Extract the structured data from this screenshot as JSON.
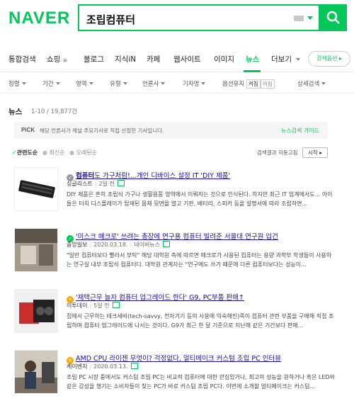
{
  "header": {
    "logo": "NAVER",
    "query": "조립컴퓨터"
  },
  "tabs": [
    {
      "label": "통합검색"
    },
    {
      "label": "쇼핑"
    },
    {
      "label": "블로그"
    },
    {
      "label": "지식iN"
    },
    {
      "label": "카페"
    },
    {
      "label": "웹사이트"
    },
    {
      "label": "이미지"
    },
    {
      "label": "뉴스"
    },
    {
      "label": "더보기"
    }
  ],
  "search_option_label": "검색옵션 ▸",
  "filters": [
    "정렬",
    "기간",
    "영역",
    "유형",
    "언론사",
    "기자명",
    "옵션유지",
    "상세검색"
  ],
  "option_toggle": {
    "on": "켜짐",
    "off": "꺼짐"
  },
  "news": {
    "title": "뉴스",
    "count": "1-10 / 19,877건"
  },
  "pick": {
    "label": "PiCK",
    "desc": "해당 언론사가 채널 주요기사로 직접 선정한 기사입니다.",
    "guide": "뉴스검색 가이드"
  },
  "sort": {
    "relevance": "관련도순",
    "latest": "최신순",
    "oldest": "오래된순",
    "auto": "검색결과 자동고침",
    "start": "시작 ▸"
  },
  "items": [
    {
      "title_hl": "컴퓨터",
      "title": "도 가구처럼!...개인 디바이스 설정 IT 'DIY 제품'",
      "press": "싱글리스트",
      "date": "2일 전",
      "desc": "DIY 제품은 흔히 조립식 가구나 생활용품 영역에서 이뤄지는 것으로 인식된다. 하지만 최근 IT 업계에서도... 아이들은 터치 디스플레이가 탑재된 몸체 뒷면을 열고 기판, 배터리, 스피커 등을 설명서에 따라 조립하면..."
    },
    {
      "title_hl": "컴퓨터",
      "title": "'미스크 매크로' 쓰려는 총장에 연구용 컴퓨터 빌려준 서울대 연구원 입건",
      "press": "중앙일보",
      "date": "2020.03.18.",
      "extra": "네이버뉴스",
      "desc": "\"일반 컴퓨터보다 빨라서 부탁\" 해당 대학원 측에 따르면 매크로가 사용된 컴퓨터는 용량 과학부 학생들이 사용하는 연구실 내부 조립식 컴퓨터다. 대학원 관계자는 \"연구에도 쓰기 때문에 다른 컴퓨터보다는 성능이..."
    },
    {
      "title_hl": "컴퓨터",
      "title": "'재택근무 늘자 컴퓨터 업그레이드 한다' G9, PC부품 판매↑",
      "press": "이투데이",
      "date": "5일 전",
      "desc": "집에서 근무하는 테크세비(tech-savvy, 전자기기 등의 사용에 익숙해진)족이 컴퓨터 관련 부품을 구매해 직접 조립하며 컴퓨터 업그레이드에 나서는 것이다. G9가 최근 한 달 기준으로 지난해 같은 기간보다 판매..."
    },
    {
      "title_hl": "조립",
      "title": "AMD CPU 라이젠 무엇이? 걱정없다, 얼티메이크 커스텀 조립 PC 인터뷰",
      "press": "케이벤치",
      "date": "2020.03.13.",
      "desc": "조립 PC 시장 중에서도 커스텀 조립 PC는 비교적 컴퓨터에 대한 관심있거나, 최고의 성능을 원하거나 혹은 LED와 같은 감성을 챙기는 소비자들이 찾는 PC가 바로 커스텀 조립 PC다. 이번에 소개할 얼티메이크는 커스텀..."
    }
  ]
}
